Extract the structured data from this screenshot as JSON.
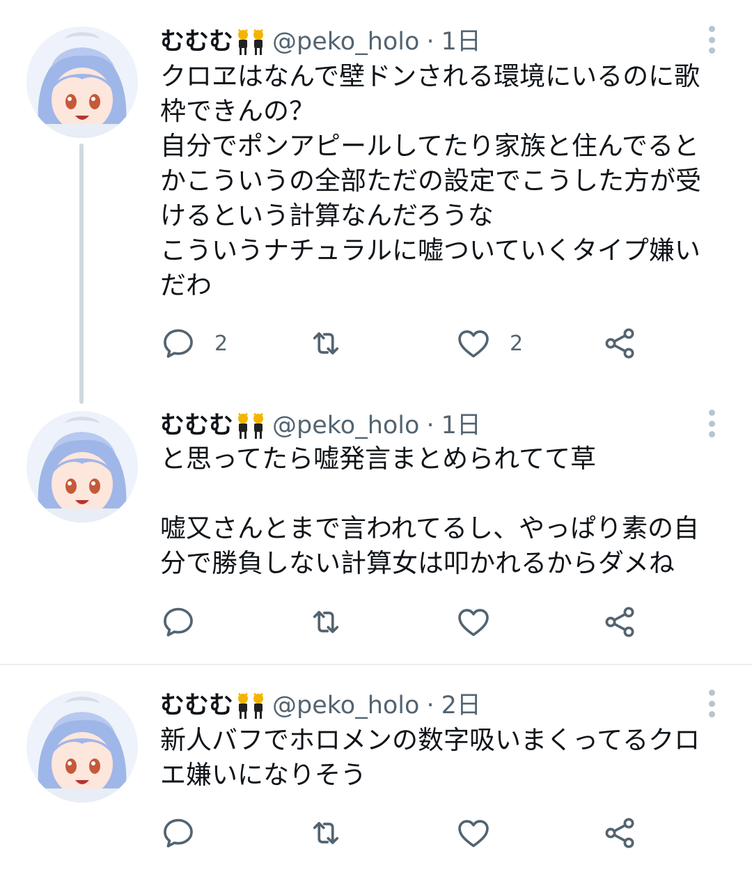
{
  "tweets": [
    {
      "name": "むむむ",
      "handle": "@peko_holo",
      "separator": "·",
      "time": "1日",
      "text": "クロヱはなんで壁ドンされる環境にいるのに歌枠できんの？\n自分でポンアピールしてたり家族と住んでるとかこういうの全部ただの設定でこうした方が受けるという計算なんだろうな\nこういうナチュラルに嘘ついていくタイプ嫌いだわ",
      "reply_count": "2",
      "retweet_count": "",
      "like_count": "2"
    },
    {
      "name": "むむむ",
      "handle": "@peko_holo",
      "separator": "·",
      "time": "1日",
      "text": "と思ってたら嘘発言まとめられてて草\n\n嘘又さんとまで言われてるし、やっぱり素の自分で勝負しない計算女は叩かれるからダメね",
      "reply_count": "",
      "retweet_count": "",
      "like_count": ""
    },
    {
      "name": "むむむ",
      "handle": "@peko_holo",
      "separator": "·",
      "time": "2日",
      "text": "新人バフでホロメンの数字吸いまくってるクロエ嫌いになりそう",
      "reply_count": "",
      "retweet_count": "",
      "like_count": ""
    }
  ],
  "icons": {
    "name_emoji": "dancers-emoji-icon",
    "more": "more-vertical-icon",
    "reply": "reply-icon",
    "retweet": "retweet-icon",
    "like": "heart-icon",
    "share": "share-icon"
  },
  "colors": {
    "text": "#0f1419",
    "secondary": "#536471",
    "thread_line": "#cfd9de",
    "divider": "#eceff1",
    "avatar_hair": "#9fb6e8",
    "emoji": "#f4b400"
  }
}
